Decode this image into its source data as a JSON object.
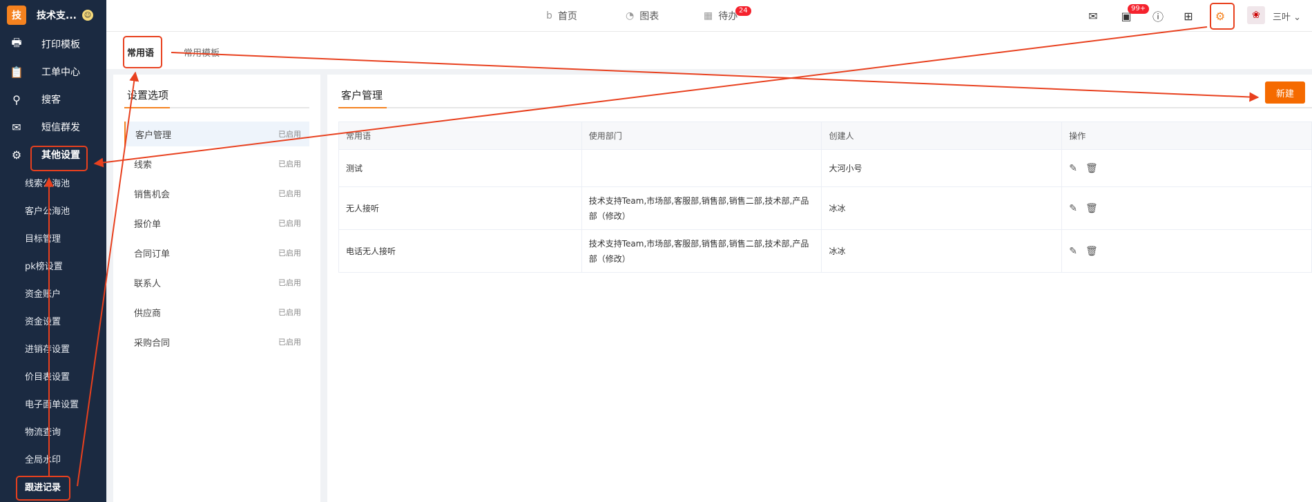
{
  "brand": {
    "logo": "技",
    "name": "技术支...",
    "emoji": "☺"
  },
  "sidebar": {
    "items": [
      {
        "label": "打印模板",
        "icon": "printer-icon",
        "glyph": "🖶"
      },
      {
        "label": "工单中心",
        "icon": "clipboard-icon",
        "glyph": "📋"
      },
      {
        "label": "搜客",
        "icon": "search-icon",
        "glyph": "⚲"
      },
      {
        "label": "短信群发",
        "icon": "mail-icon",
        "glyph": "✉"
      },
      {
        "label": "其他设置",
        "icon": "gear-icon",
        "glyph": "⚙"
      }
    ],
    "subitems": [
      "线索公海池",
      "客户公海池",
      "目标管理",
      "pk榜设置",
      "资金账户",
      "资金设置",
      "进销存设置",
      "价目表设置",
      "电子面单设置",
      "物流查询",
      "全局水印",
      "跟进记录"
    ]
  },
  "topnav": {
    "home": "首页",
    "chart": "图表",
    "todo": "待办",
    "todo_badge": "24",
    "msg_badge": "99+"
  },
  "user": {
    "name": "三叶"
  },
  "page_tabs": {
    "tab1": "常用语",
    "tab2": "常用模板"
  },
  "left_panel": {
    "title": "设置选项",
    "options": [
      {
        "label": "客户管理",
        "status": "已启用"
      },
      {
        "label": "线索",
        "status": "已启用"
      },
      {
        "label": "销售机会",
        "status": "已启用"
      },
      {
        "label": "报价单",
        "status": "已启用"
      },
      {
        "label": "合同订单",
        "status": "已启用"
      },
      {
        "label": "联系人",
        "status": "已启用"
      },
      {
        "label": "供应商",
        "status": "已启用"
      },
      {
        "label": "采购合同",
        "status": "已启用"
      }
    ]
  },
  "right_panel": {
    "title": "客户管理",
    "new_button": "新建",
    "table": {
      "headers": [
        "常用语",
        "使用部门",
        "创建人",
        "操作"
      ],
      "rows": [
        {
          "phrase": "测试",
          "dept": "",
          "creator": "大河小号"
        },
        {
          "phrase": "无人接听",
          "dept": "技术支持Team,市场部,客服部,销售部,销售二部,技术部,产品部（修改）",
          "creator": "冰冰"
        },
        {
          "phrase": "电话无人接听",
          "dept": "技术支持Team,市场部,客服部,销售部,销售二部,技术部,产品部（修改）",
          "creator": "冰冰"
        }
      ]
    }
  },
  "colors": {
    "accent": "#f5821f",
    "annotation": "#e8401e",
    "sidebar_bg": "#1b2a41"
  }
}
